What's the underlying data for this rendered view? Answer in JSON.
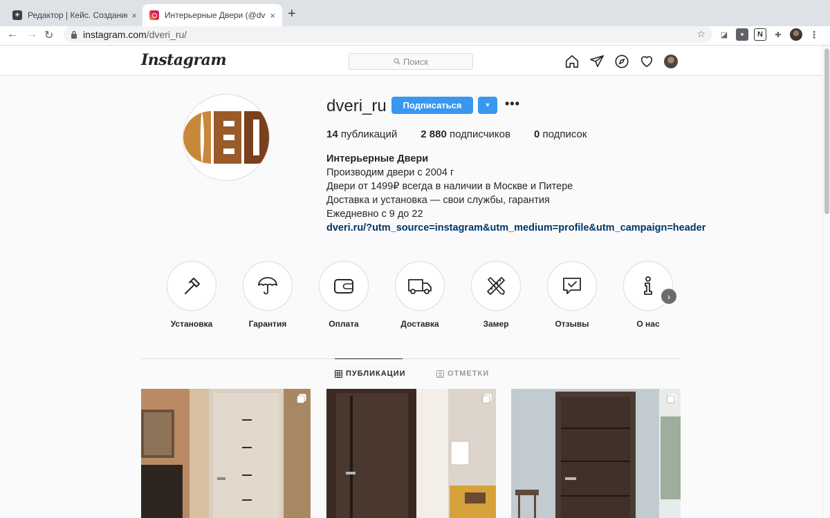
{
  "browser": {
    "tabs": [
      {
        "title": "Редактор | Кейс. Создание и",
        "close": "×"
      },
      {
        "title": "Интерьерные Двери (@dveri_",
        "close": "×"
      }
    ],
    "new_tab": "+",
    "url_host": "instagram.com",
    "url_path": "/dveri_ru/"
  },
  "header": {
    "logo": "Instagram",
    "search_placeholder": "Поиск"
  },
  "profile": {
    "username": "dveri_ru",
    "follow_label": "Подписаться",
    "dropdown": "▾",
    "more": "•••",
    "stats": [
      {
        "count": "14",
        "label": "публикаций"
      },
      {
        "count": "2 880",
        "label": "подписчиков"
      },
      {
        "count": "0",
        "label": "подписок"
      }
    ],
    "full_name": "Интерьерные Двери",
    "bio_lines": [
      "Производим двери с 2004 г",
      "Двери от 1499₽ всегда в наличии в Москве и Питере",
      "Доставка и установка — свои службы, гарантия",
      "Ежедневно с 9 до 22"
    ],
    "link": "dveri.ru/?utm_source=instagram&utm_medium=profile&utm_campaign=header"
  },
  "highlights": [
    {
      "label": "Установка",
      "icon": "hammer-icon"
    },
    {
      "label": "Гарантия",
      "icon": "umbrella-icon"
    },
    {
      "label": "Оплата",
      "icon": "wallet-icon"
    },
    {
      "label": "Доставка",
      "icon": "truck-icon"
    },
    {
      "label": "Замер",
      "icon": "ruler-pencil-icon"
    },
    {
      "label": "Отзывы",
      "icon": "review-bubble-icon"
    },
    {
      "label": "О нас",
      "icon": "info-icon"
    }
  ],
  "highlights_next": "›",
  "tabs": {
    "posts": "ПУБЛИКАЦИИ",
    "tagged": "ОТМЕТКИ"
  },
  "colors": {
    "accent": "#3897f0",
    "link": "#003569",
    "logo_light": "#c8883a",
    "logo_mid": "#9a5a2a",
    "logo_dark": "#7a3f1c"
  }
}
